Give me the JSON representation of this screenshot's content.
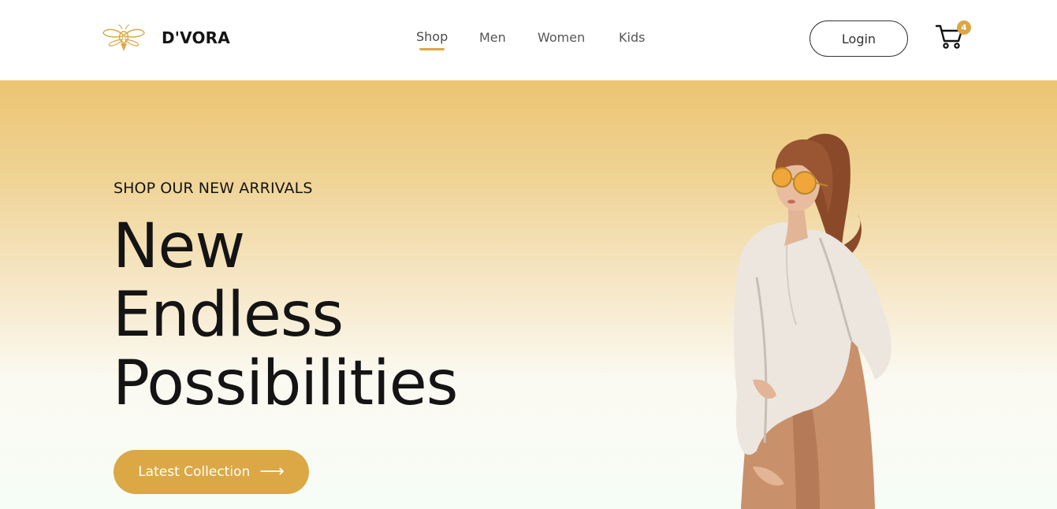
{
  "header": {
    "brand": "D'VORA",
    "nav": [
      {
        "label": "Shop",
        "active": true
      },
      {
        "label": "Men",
        "active": false
      },
      {
        "label": "Women",
        "active": false
      },
      {
        "label": "Kids",
        "active": false
      }
    ],
    "login_label": "Login",
    "cart_count": "4"
  },
  "hero": {
    "kicker": "SHOP OUR NEW ARRIVALS",
    "headline_lines": [
      "New",
      "Endless",
      "Possibilities"
    ],
    "cta_label": "Latest Collection",
    "cta_icon": "arrow-right-icon"
  },
  "colors": {
    "accent": "#dba845",
    "text": "#141414",
    "hero_top": "#ecc472",
    "hero_bottom": "#f6fcf6"
  },
  "icons": [
    "bee-logo-icon",
    "cart-icon",
    "arrow-right-icon"
  ]
}
